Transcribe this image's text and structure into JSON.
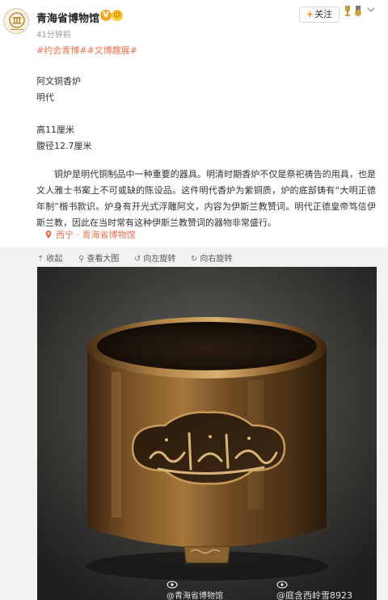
{
  "header": {
    "username": "青海省博物馆",
    "verified_badge": "V",
    "time": "41分钟前",
    "follow_label": "+关注",
    "follow_plus": "+",
    "follow_text": "关注"
  },
  "topics": [
    "#约会青博#",
    "#文博趣展#"
  ],
  "artifact": {
    "name": "阿文铜香炉",
    "dynasty": "明代",
    "height": "高11厘米",
    "belly_diameter": "腹径12.7厘米"
  },
  "description": "铜炉是明代铜制品中一种重要的器具。明清时期香炉不仅是祭祀祷告的用具，也是文人雅士书案上不可或缺的陈设品。这件明代香炉为紫铜质，炉的底部铸有“大明正德年制”楷书款识。炉身有开光式浮雕阿文，内容为伊斯兰教赞词。明代正德皇帝笃信伊斯兰教，因此在当时常有这种伊斯兰教赞词的器物非常盛行。",
  "location": "西宁 · 青海省博物馆",
  "toolbar": {
    "collapse": "收起",
    "view_large": "查看大图",
    "rotate_left": "向左旋转",
    "rotate_right": "向右旋转"
  },
  "watermarks": {
    "left": "@青海省博物馆",
    "right": "@庭含西岭雪8923"
  },
  "colors": {
    "accent": "#eb7350",
    "follow_plus": "#ff8200",
    "verified": "#f5a623"
  },
  "icons": {
    "avatar": "museum-logo",
    "badge": "verified-badge",
    "more": "chevron-down-icon",
    "location": "location-pin-icon",
    "collapse": "collapse-up-icon",
    "view": "magnifier-icon",
    "rotate_left": "rotate-left-icon",
    "rotate_right": "rotate-right-icon"
  }
}
